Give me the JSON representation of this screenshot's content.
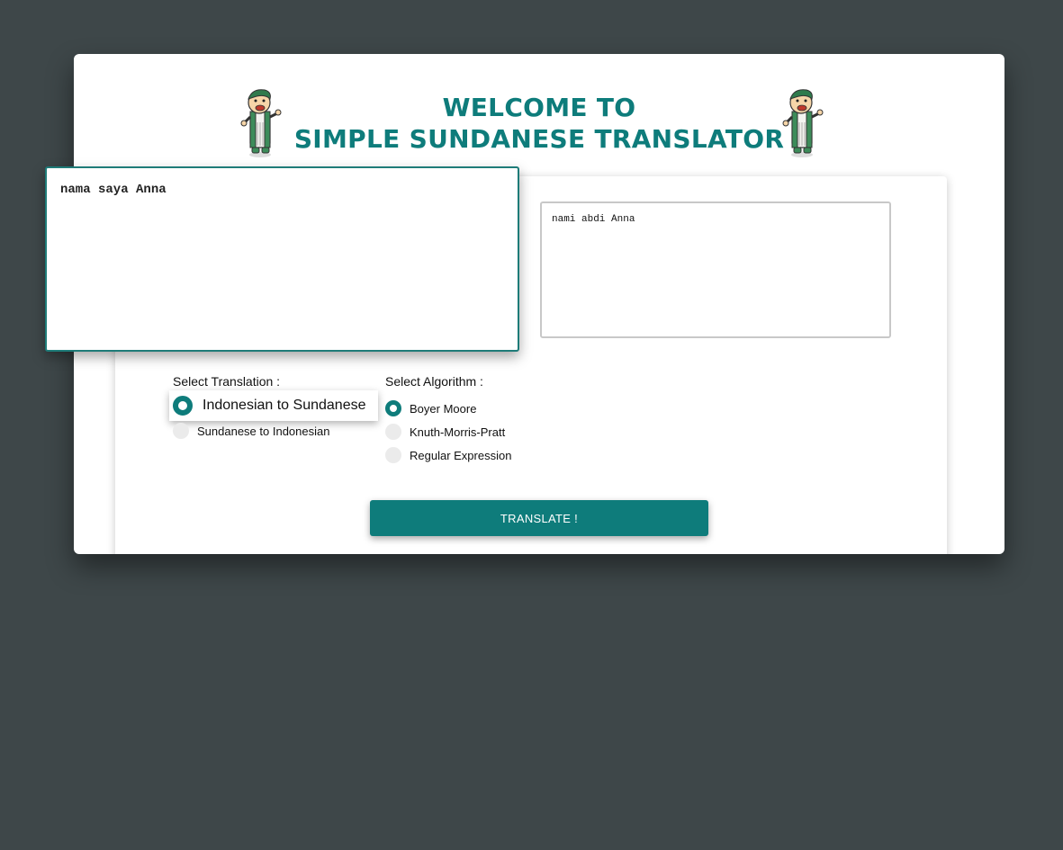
{
  "header": {
    "title_line1": "WELCOME TO",
    "title_line2": "SIMPLE SUNDANESE TRANSLATOR",
    "mascot_icon": "cartoon-mascot-icon"
  },
  "translator": {
    "input_text": "nama saya Anna",
    "output_text": "nami abdi Anna"
  },
  "translation_options": {
    "label": "Select Translation :",
    "options": [
      "Indonesian to Sundanese",
      "Sundanese to Indonesian"
    ],
    "selected": "Indonesian to Sundanese"
  },
  "algorithm_options": {
    "label": "Select Algorithm :",
    "options": [
      "Boyer Moore",
      "Knuth-Morris-Pratt",
      "Regular Expression"
    ],
    "selected": "Boyer Moore"
  },
  "action": {
    "translate_label": "TRANSLATE !"
  },
  "colors": {
    "accent": "#0e7c7b",
    "background": "#3e4749"
  }
}
